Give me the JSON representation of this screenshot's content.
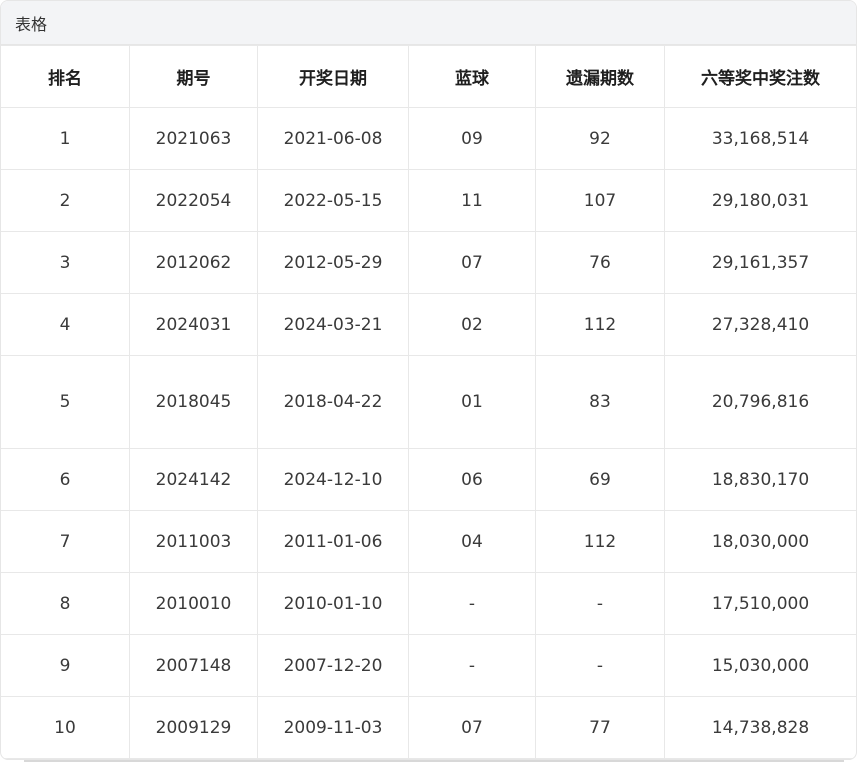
{
  "panel": {
    "title": "表格"
  },
  "table": {
    "headers": [
      "排名",
      "期号",
      "开奖日期",
      "蓝球",
      "遗漏期数",
      "六等奖中奖注数"
    ],
    "rows": [
      [
        "1",
        "2021063",
        "2021-06-08",
        "09",
        "92",
        "33,168,514"
      ],
      [
        "2",
        "2022054",
        "2022-05-15",
        "11",
        "107",
        "29,180,031"
      ],
      [
        "3",
        "2012062",
        "2012-05-29",
        "07",
        "76",
        "29,161,357"
      ],
      [
        "4",
        "2024031",
        "2024-03-21",
        "02",
        "112",
        "27,328,410"
      ],
      [
        "5",
        "2018045",
        "2018-04-22",
        "01",
        "83",
        "20,796,816"
      ],
      [
        "6",
        "2024142",
        "2024-12-10",
        "06",
        "69",
        "18,830,170"
      ],
      [
        "7",
        "2011003",
        "2011-01-06",
        "04",
        "112",
        "18,030,000"
      ],
      [
        "8",
        "2010010",
        "2010-01-10",
        "-",
        "-",
        "17,510,000"
      ],
      [
        "9",
        "2007148",
        "2007-12-20",
        "-",
        "-",
        "15,030,000"
      ],
      [
        "10",
        "2009129",
        "2009-11-03",
        "07",
        "77",
        "14,738,828"
      ]
    ]
  }
}
